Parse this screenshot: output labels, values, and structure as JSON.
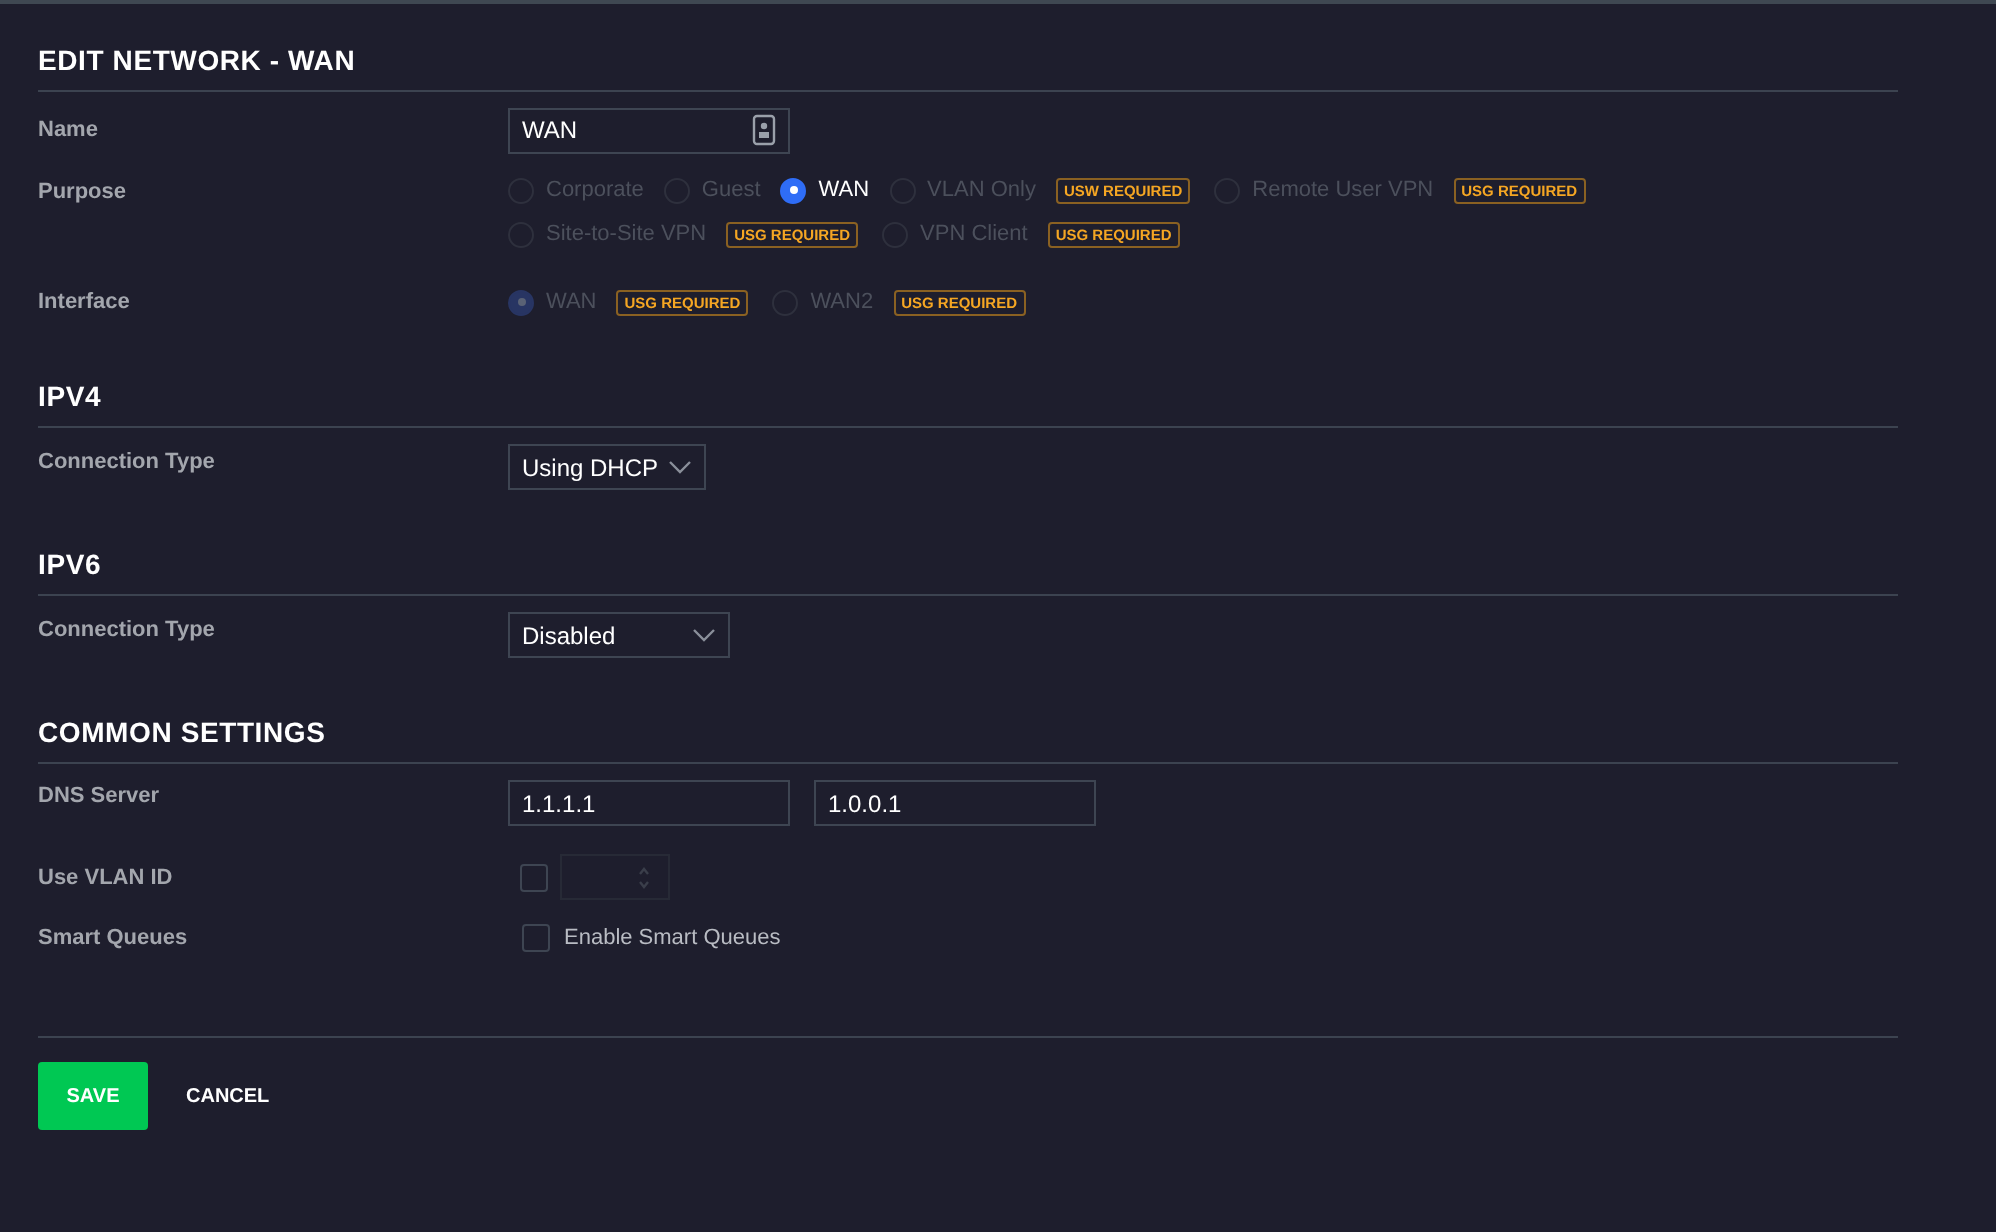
{
  "title": "EDIT NETWORK - WAN",
  "name": {
    "label": "Name",
    "value": "WAN"
  },
  "purpose": {
    "label": "Purpose",
    "options": [
      {
        "label": "Corporate",
        "selected": false,
        "disabled": true
      },
      {
        "label": "Guest",
        "selected": false,
        "disabled": true
      },
      {
        "label": "WAN",
        "selected": true,
        "disabled": false
      },
      {
        "label": "VLAN Only",
        "selected": false,
        "disabled": true,
        "badge": "USW REQUIRED"
      },
      {
        "label": "Remote User VPN",
        "selected": false,
        "disabled": true,
        "badge": "USG REQUIRED"
      },
      {
        "label": "Site-to-Site VPN",
        "selected": false,
        "disabled": true,
        "badge": "USG REQUIRED"
      },
      {
        "label": "VPN Client",
        "selected": false,
        "disabled": true,
        "badge": "USG REQUIRED"
      }
    ]
  },
  "interface": {
    "label": "Interface",
    "options": [
      {
        "label": "WAN",
        "selected": true,
        "disabled": true,
        "badge": "USG REQUIRED"
      },
      {
        "label": "WAN2",
        "selected": false,
        "disabled": true,
        "badge": "USG REQUIRED"
      }
    ]
  },
  "ipv4": {
    "heading": "IPV4",
    "label": "Connection Type",
    "value": "Using DHCP"
  },
  "ipv6": {
    "heading": "IPV6",
    "label": "Connection Type",
    "value": "Disabled"
  },
  "common": {
    "heading": "COMMON SETTINGS",
    "dns_label": "DNS Server",
    "dns": [
      "1.1.1.1",
      "1.0.0.1"
    ],
    "vlan": {
      "label": "Use VLAN ID",
      "checked": false
    },
    "smart_queues": {
      "label": "Smart Queues",
      "option": "Enable Smart Queues",
      "checked": false
    }
  },
  "buttons": {
    "save": "SAVE",
    "cancel": "CANCEL"
  }
}
